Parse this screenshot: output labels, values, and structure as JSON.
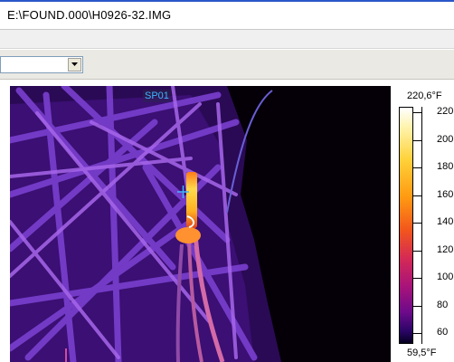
{
  "window": {
    "title": "E:\\FOUND.000\\H0926-32.IMG"
  },
  "toolbar": {
    "combo_value": ""
  },
  "image": {
    "spot_label": "SP01",
    "scale_max": "220,6°F",
    "scale_min": "59,5°F",
    "scale_ticks": [
      "220",
      "200",
      "180",
      "160",
      "140",
      "120",
      "100",
      "80",
      "60"
    ]
  }
}
